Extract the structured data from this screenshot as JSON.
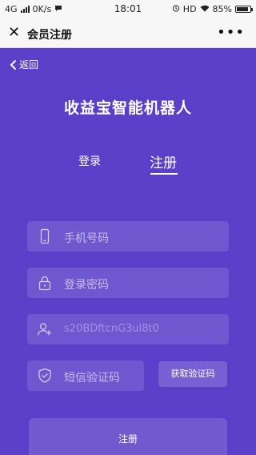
{
  "status_bar": {
    "network": "4G",
    "speed": "0K/s",
    "time": "18:01",
    "hd": "HD",
    "battery": "85%",
    "battery_level": 0.85
  },
  "title_bar": {
    "close_icon": "close-icon",
    "title": "会员注册",
    "more_icon": "more-icon"
  },
  "back": {
    "label": "返回"
  },
  "brand": {
    "title": "收益宝智能机器人"
  },
  "tabs": {
    "login": "登录",
    "register": "注册"
  },
  "form": {
    "phone": {
      "placeholder": "手机号码",
      "icon": "phone-icon"
    },
    "password": {
      "placeholder": "登录密码",
      "icon": "lock-icon"
    },
    "invite": {
      "value": "s20BDftcnG3ul8t0",
      "icon": "user-add-icon"
    },
    "sms_code": {
      "placeholder": "短信验证码",
      "icon": "shield-icon"
    },
    "get_code_label": "获取验证码",
    "submit_label": "注册"
  },
  "colors": {
    "background": "#5a3fc8",
    "text": "#ffffff"
  }
}
